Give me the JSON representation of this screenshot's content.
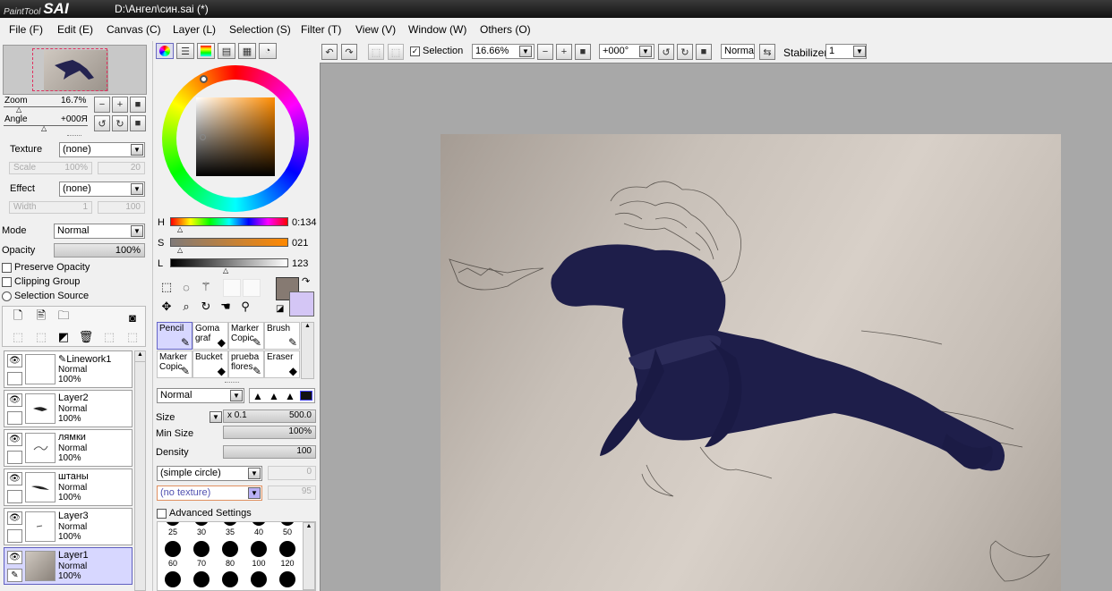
{
  "window": {
    "app_logo_small": "PaintTool",
    "app_logo_big": "SAI",
    "title": "D:\\Ангел\\син.sai (*)"
  },
  "menu": [
    "File (F)",
    "Edit (E)",
    "Canvas (C)",
    "Layer (L)",
    "Selection (S)",
    "Filter (T)",
    "View (V)",
    "Window (W)",
    "Others (O)"
  ],
  "navigator": {
    "zoom_label": "Zoom",
    "zoom_value": "16.7%",
    "angle_label": "Angle",
    "angle_value": "+000Я"
  },
  "layer_props": {
    "texture_label": "Texture",
    "texture_value": "(none)",
    "scale_label": "Scale",
    "scale_value": "100%",
    "scale_num": "20",
    "effect_label": "Effect",
    "effect_value": "(none)",
    "width_label": "Width",
    "width_value": "1",
    "width_num": "100",
    "mode_label": "Mode",
    "mode_value": "Normal",
    "opacity_label": "Opacity",
    "opacity_value": "100%",
    "preserve_opacity": "Preserve Opacity",
    "clipping_group": "Clipping Group",
    "selection_source": "Selection Source"
  },
  "layers": [
    {
      "name": "Linework1",
      "mode": "Normal",
      "opacity": "100%"
    },
    {
      "name": "Layer2",
      "mode": "Normal",
      "opacity": "100%"
    },
    {
      "name": "лямки",
      "mode": "Normal",
      "opacity": "100%"
    },
    {
      "name": "штаны",
      "mode": "Normal",
      "opacity": "100%"
    },
    {
      "name": "Layer3",
      "mode": "Normal",
      "opacity": "100%"
    },
    {
      "name": "Layer1",
      "mode": "Normal",
      "opacity": "100%"
    }
  ],
  "color": {
    "h_label": "H",
    "h_value": "0:134",
    "s_label": "S",
    "s_value": "021",
    "l_label": "L",
    "l_value": "123",
    "primary": "#867a72",
    "secondary": "#d4c6f5"
  },
  "tools": [
    {
      "label": "Pencil",
      "icon": "pencil-icon",
      "glyph": "✎"
    },
    {
      "label": "Goma graf",
      "icon": "eraser-brush-icon",
      "glyph": "◆"
    },
    {
      "label": "Marker Copic",
      "icon": "marker-icon",
      "glyph": "✎"
    },
    {
      "label": "Brush",
      "icon": "brush-icon",
      "glyph": "✎"
    },
    {
      "label": "Marker Copic",
      "icon": "marker-icon",
      "glyph": "✎"
    },
    {
      "label": "Bucket",
      "icon": "bucket-icon",
      "glyph": "◆"
    },
    {
      "label": "prueba flores",
      "icon": "brush-icon",
      "glyph": "✎"
    },
    {
      "label": "Eraser",
      "icon": "eraser-icon",
      "glyph": "◆"
    }
  ],
  "brush": {
    "mode_value": "Normal",
    "size_label": "Size",
    "size_mult": "x 0.1",
    "size_value": "500.0",
    "min_size_label": "Min Size",
    "min_size_value": "100%",
    "density_label": "Density",
    "density_value": "100",
    "shape_value": "(simple circle)",
    "shape_num": "0",
    "texture_value": "(no texture)",
    "texture_num": "95",
    "advanced": "Advanced Settings"
  },
  "brush_sizes_row1": [
    "25",
    "30",
    "35",
    "40",
    "50"
  ],
  "brush_sizes_row2": [
    "60",
    "70",
    "80",
    "100",
    "120"
  ],
  "toolbar": {
    "selection_label": "Selection",
    "zoom_value": "16.66%",
    "angle_value": "+000°",
    "blend_value": "Normal",
    "stabilizer_label": "Stabilizer",
    "stabilizer_value": "1"
  }
}
